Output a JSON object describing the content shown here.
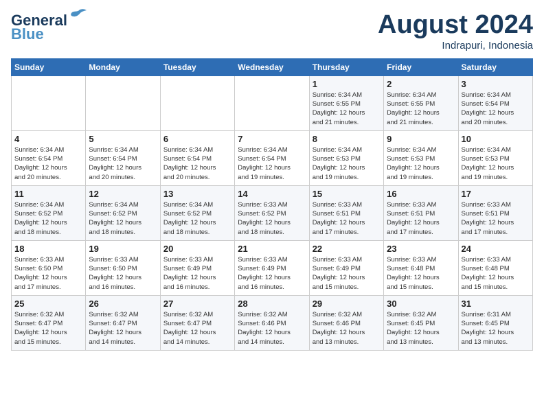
{
  "header": {
    "logo_line1": "General",
    "logo_line2": "Blue",
    "month_title": "August 2024",
    "location": "Indrapuri, Indonesia"
  },
  "weekdays": [
    "Sunday",
    "Monday",
    "Tuesday",
    "Wednesday",
    "Thursday",
    "Friday",
    "Saturday"
  ],
  "weeks": [
    [
      {
        "day": "",
        "info": ""
      },
      {
        "day": "",
        "info": ""
      },
      {
        "day": "",
        "info": ""
      },
      {
        "day": "",
        "info": ""
      },
      {
        "day": "1",
        "info": "Sunrise: 6:34 AM\nSunset: 6:55 PM\nDaylight: 12 hours\nand 21 minutes."
      },
      {
        "day": "2",
        "info": "Sunrise: 6:34 AM\nSunset: 6:55 PM\nDaylight: 12 hours\nand 21 minutes."
      },
      {
        "day": "3",
        "info": "Sunrise: 6:34 AM\nSunset: 6:54 PM\nDaylight: 12 hours\nand 20 minutes."
      }
    ],
    [
      {
        "day": "4",
        "info": "Sunrise: 6:34 AM\nSunset: 6:54 PM\nDaylight: 12 hours\nand 20 minutes."
      },
      {
        "day": "5",
        "info": "Sunrise: 6:34 AM\nSunset: 6:54 PM\nDaylight: 12 hours\nand 20 minutes."
      },
      {
        "day": "6",
        "info": "Sunrise: 6:34 AM\nSunset: 6:54 PM\nDaylight: 12 hours\nand 20 minutes."
      },
      {
        "day": "7",
        "info": "Sunrise: 6:34 AM\nSunset: 6:54 PM\nDaylight: 12 hours\nand 19 minutes."
      },
      {
        "day": "8",
        "info": "Sunrise: 6:34 AM\nSunset: 6:53 PM\nDaylight: 12 hours\nand 19 minutes."
      },
      {
        "day": "9",
        "info": "Sunrise: 6:34 AM\nSunset: 6:53 PM\nDaylight: 12 hours\nand 19 minutes."
      },
      {
        "day": "10",
        "info": "Sunrise: 6:34 AM\nSunset: 6:53 PM\nDaylight: 12 hours\nand 19 minutes."
      }
    ],
    [
      {
        "day": "11",
        "info": "Sunrise: 6:34 AM\nSunset: 6:52 PM\nDaylight: 12 hours\nand 18 minutes."
      },
      {
        "day": "12",
        "info": "Sunrise: 6:34 AM\nSunset: 6:52 PM\nDaylight: 12 hours\nand 18 minutes."
      },
      {
        "day": "13",
        "info": "Sunrise: 6:34 AM\nSunset: 6:52 PM\nDaylight: 12 hours\nand 18 minutes."
      },
      {
        "day": "14",
        "info": "Sunrise: 6:33 AM\nSunset: 6:52 PM\nDaylight: 12 hours\nand 18 minutes."
      },
      {
        "day": "15",
        "info": "Sunrise: 6:33 AM\nSunset: 6:51 PM\nDaylight: 12 hours\nand 17 minutes."
      },
      {
        "day": "16",
        "info": "Sunrise: 6:33 AM\nSunset: 6:51 PM\nDaylight: 12 hours\nand 17 minutes."
      },
      {
        "day": "17",
        "info": "Sunrise: 6:33 AM\nSunset: 6:51 PM\nDaylight: 12 hours\nand 17 minutes."
      }
    ],
    [
      {
        "day": "18",
        "info": "Sunrise: 6:33 AM\nSunset: 6:50 PM\nDaylight: 12 hours\nand 17 minutes."
      },
      {
        "day": "19",
        "info": "Sunrise: 6:33 AM\nSunset: 6:50 PM\nDaylight: 12 hours\nand 16 minutes."
      },
      {
        "day": "20",
        "info": "Sunrise: 6:33 AM\nSunset: 6:49 PM\nDaylight: 12 hours\nand 16 minutes."
      },
      {
        "day": "21",
        "info": "Sunrise: 6:33 AM\nSunset: 6:49 PM\nDaylight: 12 hours\nand 16 minutes."
      },
      {
        "day": "22",
        "info": "Sunrise: 6:33 AM\nSunset: 6:49 PM\nDaylight: 12 hours\nand 15 minutes."
      },
      {
        "day": "23",
        "info": "Sunrise: 6:33 AM\nSunset: 6:48 PM\nDaylight: 12 hours\nand 15 minutes."
      },
      {
        "day": "24",
        "info": "Sunrise: 6:33 AM\nSunset: 6:48 PM\nDaylight: 12 hours\nand 15 minutes."
      }
    ],
    [
      {
        "day": "25",
        "info": "Sunrise: 6:32 AM\nSunset: 6:47 PM\nDaylight: 12 hours\nand 15 minutes."
      },
      {
        "day": "26",
        "info": "Sunrise: 6:32 AM\nSunset: 6:47 PM\nDaylight: 12 hours\nand 14 minutes."
      },
      {
        "day": "27",
        "info": "Sunrise: 6:32 AM\nSunset: 6:47 PM\nDaylight: 12 hours\nand 14 minutes."
      },
      {
        "day": "28",
        "info": "Sunrise: 6:32 AM\nSunset: 6:46 PM\nDaylight: 12 hours\nand 14 minutes."
      },
      {
        "day": "29",
        "info": "Sunrise: 6:32 AM\nSunset: 6:46 PM\nDaylight: 12 hours\nand 13 minutes."
      },
      {
        "day": "30",
        "info": "Sunrise: 6:32 AM\nSunset: 6:45 PM\nDaylight: 12 hours\nand 13 minutes."
      },
      {
        "day": "31",
        "info": "Sunrise: 6:31 AM\nSunset: 6:45 PM\nDaylight: 12 hours\nand 13 minutes."
      }
    ]
  ]
}
